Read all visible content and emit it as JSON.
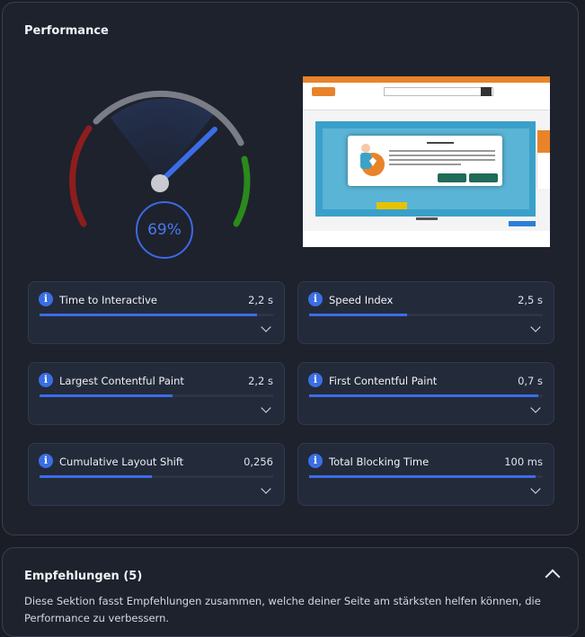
{
  "performance": {
    "title": "Performance",
    "score_label": "69%",
    "score": 0.69,
    "metrics": [
      {
        "label": "Time to Interactive",
        "value": "2,2 s",
        "fill": 0.93
      },
      {
        "label": "Speed Index",
        "value": "2,5 s",
        "fill": 0.42
      },
      {
        "label": "Largest Contentful Paint",
        "value": "2,2 s",
        "fill": 0.57
      },
      {
        "label": "First Contentful Paint",
        "value": "0,7 s",
        "fill": 0.98
      },
      {
        "label": "Cumulative Layout Shift",
        "value": "0,256",
        "fill": 0.48
      },
      {
        "label": "Total Blocking Time",
        "value": "100 ms",
        "fill": 0.97
      }
    ],
    "colors": {
      "accent": "#3b6de6",
      "gauge_red": "#8e1d1d",
      "gauge_green": "#2a8a1c",
      "gauge_grey": "#7a7d86"
    }
  },
  "recommendations": {
    "title": "Empfehlungen (5)",
    "description": "Diese Sektion fasst Empfehlungen zusammen, welche deiner Seite am stärksten helfen können, die Performance zu verbessern."
  }
}
